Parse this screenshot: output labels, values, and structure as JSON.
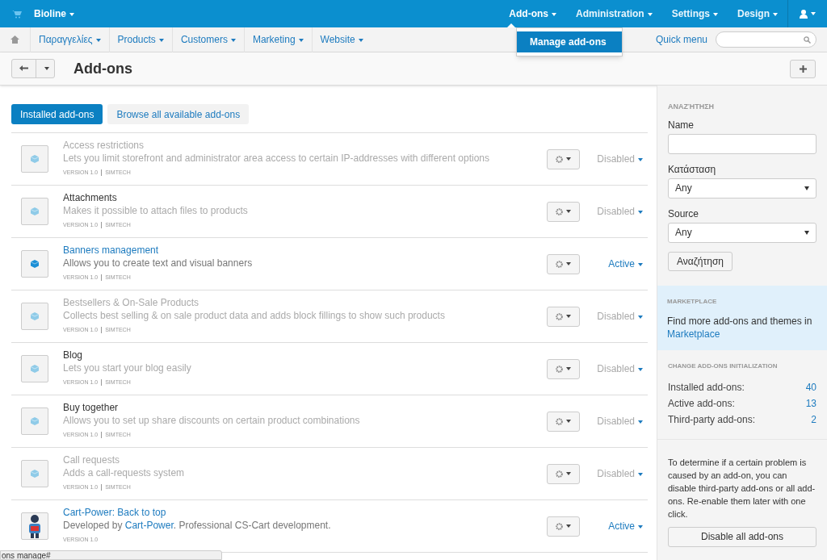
{
  "topbar": {
    "brand": "Bioline",
    "menus": [
      {
        "label": "Add-ons",
        "selected": true
      },
      {
        "label": "Administration",
        "selected": false
      },
      {
        "label": "Settings",
        "selected": false
      },
      {
        "label": "Design",
        "selected": false
      }
    ],
    "dropdown": [
      "Manage add-ons"
    ]
  },
  "navbar": {
    "items": [
      "Παραγγελίες",
      "Products",
      "Customers",
      "Marketing",
      "Website"
    ],
    "quick_menu": "Quick menu"
  },
  "page": {
    "title": "Add-ons"
  },
  "tabs": [
    {
      "label": "Installed add-ons",
      "selected": true
    },
    {
      "label": "Browse all available add-ons",
      "selected": false
    }
  ],
  "addons": [
    {
      "name": "Access restrictions",
      "dimmed": true,
      "description": [
        {
          "text": "Lets you limit storefront and administrator area access to certain IP-addresses with different options",
          "link": false
        }
      ],
      "version": "VERSION 1.0",
      "vendor": "SIMTECH",
      "status": "Disabled",
      "active": false
    },
    {
      "name": "Attachments",
      "dimmed": false,
      "description": [
        {
          "text": "Makes it possible to attach files to products",
          "link": false
        }
      ],
      "version": "VERSION 1.0",
      "vendor": "SIMTECH",
      "status": "Disabled",
      "active": false
    },
    {
      "name": "Banners management",
      "description": [
        {
          "text": "Allows you to create text and visual banners",
          "link": false
        }
      ],
      "version": "VERSION 1.0",
      "vendor": "SIMTECH",
      "status": "Active",
      "active": true
    },
    {
      "name": "Bestsellers & On-Sale Products",
      "dimmed": true,
      "description": [
        {
          "text": "Collects best selling & on sale product data and adds block fillings to show such products",
          "link": false
        }
      ],
      "version": "VERSION 1.0",
      "vendor": "SIMTECH",
      "status": "Disabled",
      "active": false
    },
    {
      "name": "Blog",
      "dimmed": false,
      "description": [
        {
          "text": "Lets you start your blog easily",
          "link": false
        }
      ],
      "version": "VERSION 1.0",
      "vendor": "SIMTECH",
      "status": "Disabled",
      "active": false
    },
    {
      "name": "Buy together",
      "dimmed": false,
      "description": [
        {
          "text": "Allows you to set up share discounts on certain product combinations",
          "link": false
        }
      ],
      "version": "VERSION 1.0",
      "vendor": "SIMTECH",
      "status": "Disabled",
      "active": false
    },
    {
      "name": "Call requests",
      "dimmed": true,
      "description": [
        {
          "text": "Adds a call-requests system",
          "link": false
        }
      ],
      "version": "VERSION 1.0",
      "vendor": "SIMTECH",
      "status": "Disabled",
      "active": false
    },
    {
      "name": "Cart-Power: Back to top",
      "description": [
        {
          "text": "Developed by ",
          "link": false
        },
        {
          "text": "Cart-Power",
          "link": true
        },
        {
          "text": ". Professional CS-Cart development.",
          "link": false
        }
      ],
      "version": "VERSION 1.0",
      "status": "Active",
      "active": true,
      "kind": "third_party"
    }
  ],
  "sidebar": {
    "search_heading": "ΑΝΑΖΉΤΗΣΗ",
    "fields": [
      {
        "label": "Name",
        "kind": "text"
      },
      {
        "label": "Κατάσταση",
        "kind": "select",
        "value": "Any"
      },
      {
        "label": "Source",
        "kind": "select",
        "value": "Any"
      }
    ],
    "search_button": "Αναζήτηση",
    "marketplace": {
      "heading": "MARKETPLACE",
      "text": "Find more add-ons and themes in",
      "link": "Marketplace"
    },
    "stats_heading": "CHANGE ADD-ONS INITIALIZATION",
    "stats": [
      {
        "label": "Installed add-ons:",
        "value": "40"
      },
      {
        "label": "Active add-ons:",
        "value": "13"
      },
      {
        "label": "Third-party add-ons:",
        "value": "2"
      }
    ],
    "help": "To determine if a certain problem is caused by an add-on, you can disable third-party add-ons or all add-ons. Re-enable them later with one click.",
    "disable_button": "Disable all add-ons"
  },
  "status_link": "ons manage#"
}
